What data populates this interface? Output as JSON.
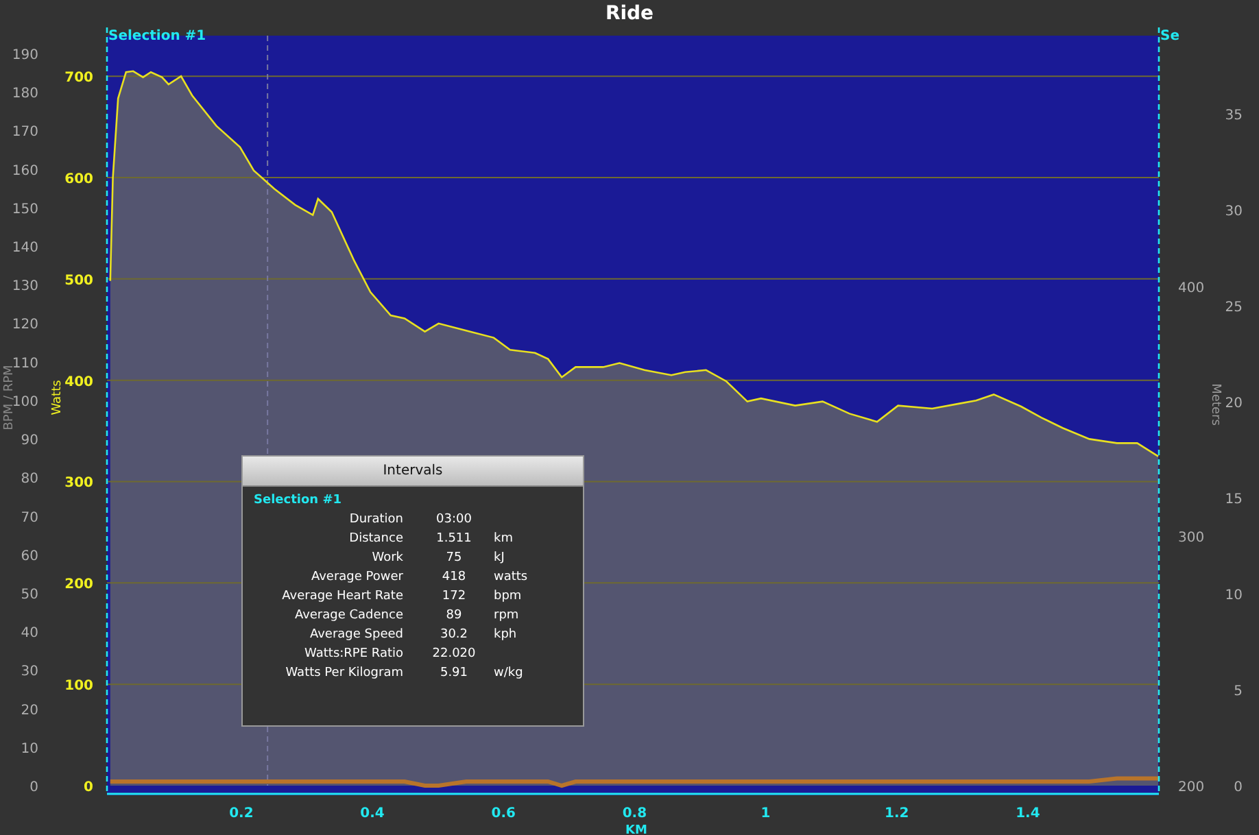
{
  "window": {
    "title": "Ride"
  },
  "chart": {
    "selection_labels": [
      "Selection #1",
      "Se"
    ],
    "left_axis": {
      "label": "BPM / RPM",
      "ticks": [
        "190",
        "180",
        "170",
        "160",
        "150",
        "140",
        "130",
        "120",
        "110",
        "100",
        "90",
        "80",
        "70",
        "60",
        "50",
        "40",
        "30",
        "20",
        "10",
        "0"
      ]
    },
    "meters_axis": {
      "label": "Meters",
      "ticks": [
        "400",
        "300",
        "200"
      ]
    },
    "right_axis": {
      "ticks": [
        "35",
        "30",
        "25",
        "20",
        "15",
        "10",
        "5",
        "0"
      ]
    },
    "chart_data": {
      "type": "area",
      "xlabel": "KM",
      "ylabel": "Watts",
      "xlim": [
        -0.005,
        1.6
      ],
      "ylim": [
        0,
        740
      ],
      "grid": true,
      "ref_lines": [
        {
          "axis": "x",
          "value": 0.24
        }
      ],
      "xticks": [
        0.2,
        0.4,
        0.6,
        0.8,
        1,
        1.2,
        1.4
      ],
      "yticks": [
        0,
        100,
        200,
        300,
        400,
        500,
        600,
        700
      ],
      "x": [
        0,
        0.004,
        0.012,
        0.024,
        0.035,
        0.05,
        0.062,
        0.079,
        0.089,
        0.108,
        0.125,
        0.162,
        0.198,
        0.219,
        0.25,
        0.282,
        0.309,
        0.317,
        0.338,
        0.372,
        0.397,
        0.428,
        0.449,
        0.48,
        0.501,
        0.543,
        0.585,
        0.61,
        0.648,
        0.668,
        0.689,
        0.71,
        0.752,
        0.777,
        0.815,
        0.856,
        0.877,
        0.909,
        0.94,
        0.972,
        0.993,
        1.045,
        1.087,
        1.128,
        1.17,
        1.202,
        1.254,
        1.296,
        1.321,
        1.348,
        1.39,
        1.421,
        1.453,
        1.494,
        1.536,
        1.567,
        1.599
      ],
      "series": [
        {
          "type": "line",
          "color": "#b8742a",
          "values": [
            4,
            4,
            4,
            4,
            4,
            4,
            4,
            4,
            4,
            4,
            4,
            4,
            4,
            4,
            4,
            4,
            4,
            4,
            4,
            4,
            4,
            4,
            4,
            0,
            0,
            4,
            4,
            4,
            4,
            4,
            0,
            4,
            4,
            4,
            4,
            4,
            4,
            4,
            4,
            4,
            4,
            4,
            4,
            4,
            4,
            4,
            4,
            4,
            4,
            4,
            4,
            4,
            4,
            4,
            7,
            7,
            7
          ]
        },
        {
          "type": "area",
          "color": "#e8e020",
          "values": [
            498,
            600,
            678,
            704,
            705,
            699,
            704,
            699,
            692,
            700,
            681,
            651,
            630,
            607,
            589,
            573,
            563,
            579,
            566,
            518,
            487,
            464,
            461,
            448,
            456,
            449,
            442,
            430,
            427,
            421,
            403,
            413,
            413,
            417,
            410,
            405,
            408,
            410,
            399,
            379,
            382,
            375,
            379,
            367,
            359,
            375,
            372,
            377,
            380,
            386,
            374,
            363,
            353,
            342,
            338,
            338,
            325
          ]
        }
      ]
    }
  },
  "intervals": {
    "title": "Intervals",
    "selection": "Selection #1",
    "rows": [
      {
        "label": "Duration",
        "value": "03:00",
        "unit": ""
      },
      {
        "label": "Distance",
        "value": "1.511",
        "unit": "km"
      },
      {
        "label": "Work",
        "value": "75",
        "unit": "kJ"
      },
      {
        "label": "Average Power",
        "value": "418",
        "unit": "watts"
      },
      {
        "label": "Average Heart Rate",
        "value": "172",
        "unit": "bpm"
      },
      {
        "label": "Average Cadence",
        "value": "89",
        "unit": "rpm"
      },
      {
        "label": "Average Speed",
        "value": "30.2",
        "unit": "kph"
      },
      {
        "label": "Watts:RPE Ratio",
        "value": "22.020",
        "unit": ""
      },
      {
        "label": "Watts Per Kilogram",
        "value": "5.91",
        "unit": "w/kg"
      }
    ]
  }
}
